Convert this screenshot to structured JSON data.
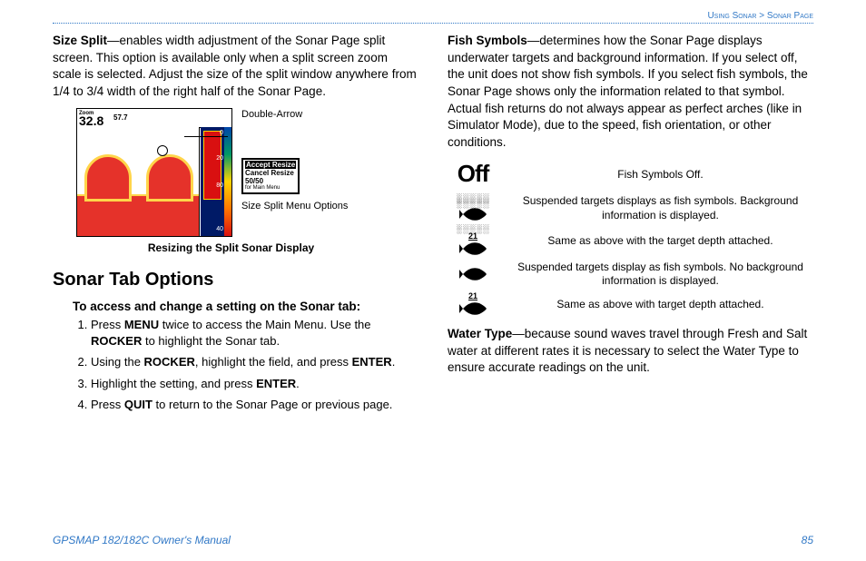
{
  "breadcrumb": {
    "before": "Using Sonar",
    "sep": " > ",
    "after": "Sonar Page"
  },
  "left": {
    "sizeSplit": {
      "term": "Size Split",
      "text": "—enables width adjustment of the Sonar Page split screen. This option is available only when a split screen zoom scale is selected. Adjust the size of the split window anywhere from 1/4 to 3/4 width of the right half of the Sonar Page."
    },
    "figure": {
      "zoomLabel": "Zoom",
      "bigNumber": "32.8",
      "subNumber": "57.7",
      "arrowLabel": "Double-Arrow",
      "menu": {
        "l1": "Accept Resize",
        "l2": "Cancel Resize",
        "l3": "50/50",
        "l4": "for Main Menu"
      },
      "menuLabel": "Size Split Menu Options",
      "caption": "Resizing the Split Sonar Display"
    },
    "sectionTitle": "Sonar Tab Options",
    "subhead": "To access and change a setting on the Sonar tab:",
    "steps": {
      "s1a": "Press ",
      "s1b": "MENU",
      "s1c": " twice to access the Main Menu. Use the ",
      "s1d": "ROCKER",
      "s1e": " to highlight the Sonar tab.",
      "s2a": "Using the ",
      "s2b": "ROCKER",
      "s2c": ", highlight the field, and press ",
      "s2d": "ENTER",
      "s2e": ".",
      "s3a": "Highlight the setting, and press ",
      "s3b": "ENTER",
      "s3c": ".",
      "s4a": "Press ",
      "s4b": "QUIT",
      "s4c": " to return to the Sonar Page or previous page."
    }
  },
  "right": {
    "fishSymbols": {
      "term": "Fish Symbols",
      "text": "—determines how the Sonar Page displays underwater targets and background information. If you select off, the unit does not show fish symbols. If you select fish symbols, the Sonar Page shows only the information related to that symbol. Actual fish returns do not always appear as perfect arches (like in Simulator Mode), due to the speed, fish orientation, or other conditions."
    },
    "symbols": {
      "offWord": "Off",
      "r1": "Fish Symbols Off.",
      "r2": "Suspended targets displays as fish symbols. Background information is displayed.",
      "depth": "21",
      "r3": "Same as above with the target depth attached.",
      "r4": "Suspended targets display as fish symbols. No background information is displayed.",
      "r5": "Same as above with target depth attached."
    },
    "waterType": {
      "term": "Water Type",
      "text": "—because sound waves travel through Fresh and Salt water at different rates it is necessary to select the Water Type to ensure accurate readings on the unit."
    }
  },
  "footer": {
    "title": "GPSMAP 182/182C Owner's Manual",
    "page": "85"
  }
}
